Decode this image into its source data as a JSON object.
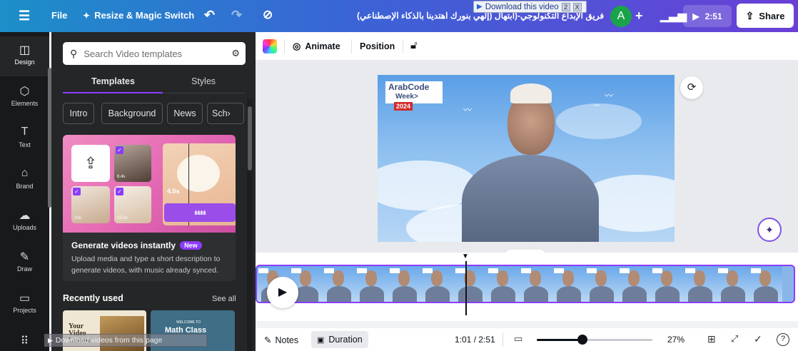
{
  "topbar": {
    "file_label": "File",
    "resize_label": "Resize & Magic Switch",
    "doc_title": "فريق الإبداع التكنولوجي-(ابتهال (إلهي بنورك اهتدينا بالذكاء الإصطناعي)",
    "download_label": "Download this video",
    "download_badge": "2",
    "download_close": "X",
    "avatar_initial": "A",
    "present_time": "2:51",
    "share_label": "Share"
  },
  "rail": {
    "items": [
      {
        "label": "Design",
        "icon": "design-icon"
      },
      {
        "label": "Elements",
        "icon": "elements-icon"
      },
      {
        "label": "Text",
        "icon": "text-icon"
      },
      {
        "label": "Brand",
        "icon": "brand-icon"
      },
      {
        "label": "Uploads",
        "icon": "uploads-icon"
      },
      {
        "label": "Draw",
        "icon": "draw-icon"
      },
      {
        "label": "Projects",
        "icon": "projects-icon"
      }
    ]
  },
  "panel": {
    "search_placeholder": "Search Video templates",
    "tabs": [
      "Templates",
      "Styles"
    ],
    "chips": [
      "Intro",
      "Background",
      "News",
      "Sch"
    ],
    "promo": {
      "title": "Generate videos instantly",
      "badge": "New",
      "desc": "Upload media and type a short description to generate videos, with music already synced.",
      "time_label": "4.0s",
      "tile_label_1": "10s",
      "tile_label_2": "15.0s",
      "tile_label_3": "6.4s"
    },
    "recent_title": "Recently used",
    "see_all": "See all",
    "recent": [
      {
        "title": "Your Video Lesson"
      },
      {
        "welcome": "WELCOME TO",
        "title": "Math Class"
      }
    ]
  },
  "toolbar": {
    "animate_label": "Animate",
    "position_label": "Position"
  },
  "canvas": {
    "logo_text": "ArabCode",
    "logo_sub": "Week>",
    "logo_year": "2024"
  },
  "bottombar": {
    "notes_label": "Notes",
    "duration_label": "Duration",
    "time_display": "1:01 / 2:51",
    "zoom_value": "27%",
    "zoom_fraction": 0.27,
    "help_label": "?"
  },
  "overlay": {
    "text": "Download videos from this page"
  },
  "colors": {
    "accent": "#8b3dff",
    "avatar": "#1aa34a"
  }
}
